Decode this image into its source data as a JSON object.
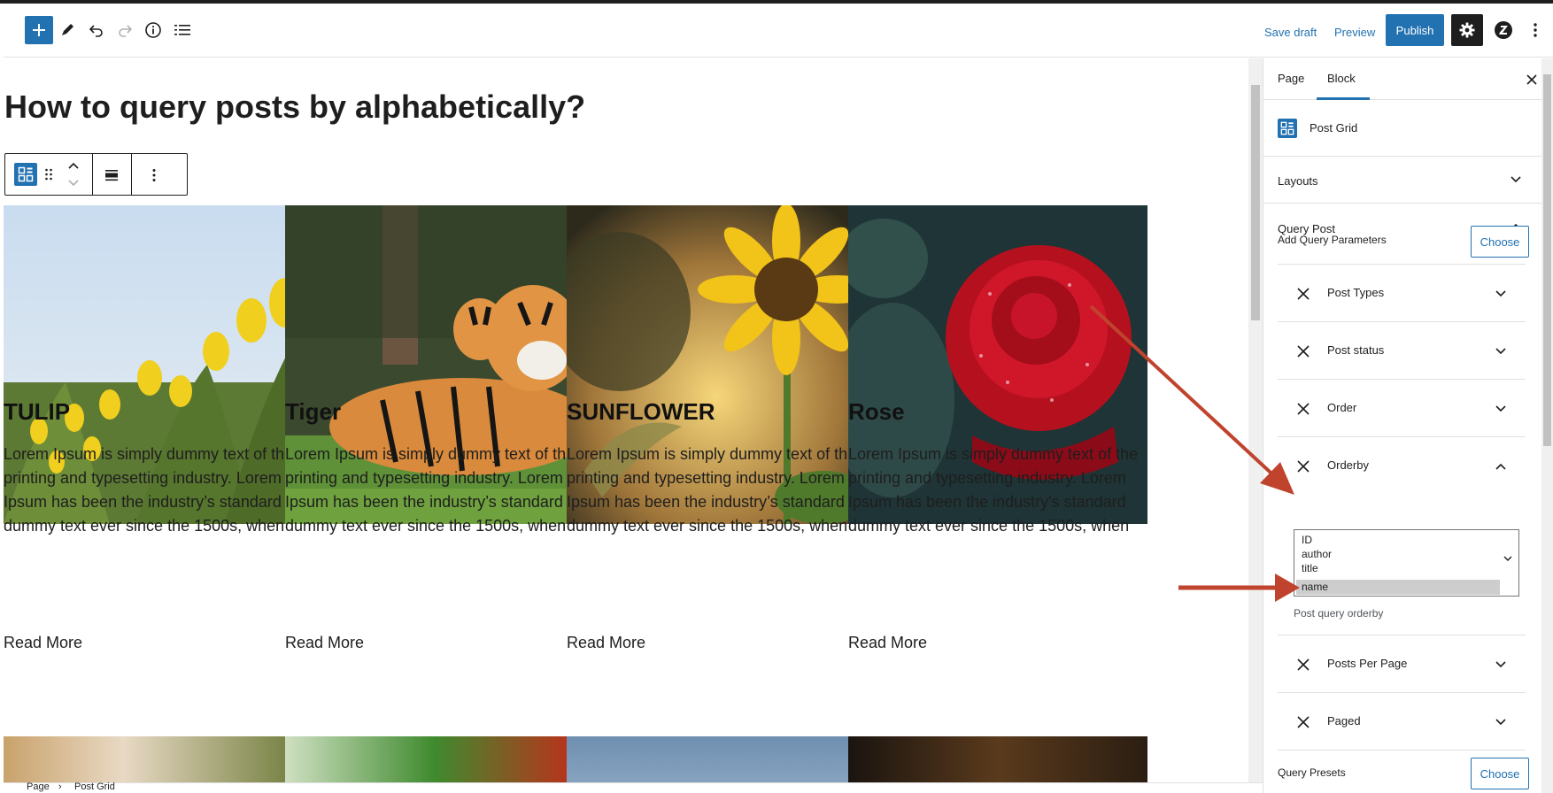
{
  "toolbar": {
    "add_icon": "plus-icon",
    "tools_icon": "pencil-icon",
    "undo_icon": "undo-icon",
    "redo_icon": "redo-icon",
    "details_icon": "info-icon",
    "outline_icon": "list-view-icon",
    "save_draft": "Save draft",
    "preview": "Preview",
    "publish": "Publish",
    "settings_icon": "gear-icon",
    "plugin_icon": "plugin-logo-icon",
    "options_icon": "more-vertical-icon",
    "accent": "#2271b1"
  },
  "page": {
    "title": "How to query posts by alphabetically?"
  },
  "posts": [
    {
      "title": "TULIP",
      "excerpt_lines": [
        "Lorem Ipsum is simply dummy text of the",
        "printing and typesetting industry. Lorem",
        "Ipsum has been the industry’s standard",
        "dummy text ever since the 1500s, when"
      ],
      "read_more": "Read More",
      "image": "yellow-tulips"
    },
    {
      "title": "Tiger",
      "excerpt_lines": [
        "Lorem Ipsum is simply dummy text of the",
        "printing and typesetting industry. Lorem",
        "Ipsum has been the industry’s standard",
        "dummy text ever since the 1500s, when"
      ],
      "read_more": "Read More",
      "image": "tigers-on-grass"
    },
    {
      "title": "SUNFLOWER",
      "excerpt_lines": [
        "Lorem Ipsum is simply dummy text of the",
        "printing and typesetting industry. Lorem",
        "Ipsum has been the industry’s standard",
        "dummy text ever since the 1500s, when"
      ],
      "read_more": "Read More",
      "image": "sunflower-at-sunset"
    },
    {
      "title": "Rose",
      "excerpt_lines": [
        "Lorem Ipsum is simply dummy text of the",
        "printing and typesetting industry. Lorem",
        "Ipsum has been the industry's standard",
        "dummy text ever since the 1500s, when"
      ],
      "read_more": "Read More",
      "image": "red-rose"
    }
  ],
  "footer": {
    "breadcrumb": [
      "Page",
      "Post Grid"
    ]
  },
  "sidebar": {
    "tabs": [
      {
        "label": "Page",
        "active": false
      },
      {
        "label": "Block",
        "active": true
      }
    ],
    "block_name": "Post Grid",
    "layouts": "Layouts",
    "query_post": "Query Post",
    "add_query_params": "Add Query Parameters",
    "choose": "Choose",
    "params": [
      {
        "label": "Post Types",
        "expanded": false
      },
      {
        "label": "Post status",
        "expanded": false
      },
      {
        "label": "Order",
        "expanded": false
      },
      {
        "label": "Orderby",
        "expanded": true
      },
      {
        "label": "Posts Per Page",
        "expanded": false
      },
      {
        "label": "Paged",
        "expanded": false
      }
    ],
    "orderby_options": [
      "ID",
      "author",
      "title",
      "name"
    ],
    "orderby_selected": "name",
    "orderby_help": "Post query orderby",
    "query_presets": "Query Presets",
    "presets_choose": "Choose"
  },
  "annotation": {
    "arrow_color": "#c0432e"
  }
}
